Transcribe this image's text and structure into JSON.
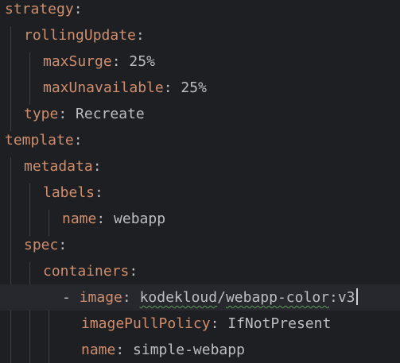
{
  "editor": {
    "language": "yaml",
    "lines": [
      {
        "indent": 0,
        "key": "strategy",
        "value": ""
      },
      {
        "indent": 1,
        "key": "rollingUpdate",
        "value": ""
      },
      {
        "indent": 2,
        "key": "maxSurge",
        "value": "25%"
      },
      {
        "indent": 2,
        "key": "maxUnavailable",
        "value": "25%"
      },
      {
        "indent": 1,
        "key": "type",
        "value": "Recreate"
      },
      {
        "indent": 0,
        "key": "template",
        "value": ""
      },
      {
        "indent": 1,
        "key": "metadata",
        "value": ""
      },
      {
        "indent": 2,
        "key": "labels",
        "value": ""
      },
      {
        "indent": 3,
        "key": "name",
        "value": "webapp"
      },
      {
        "indent": 1,
        "key": "spec",
        "value": ""
      },
      {
        "indent": 2,
        "key": "containers",
        "value": ""
      },
      {
        "indent": 3,
        "dash": "- ",
        "key": "image",
        "value_parts": [
          "kodekloud",
          "/",
          "webapp-color",
          ":v3"
        ],
        "current": true
      },
      {
        "indent": 4,
        "key": "imagePullPolicy",
        "value": "IfNotPresent"
      },
      {
        "indent": 4,
        "key": "name",
        "value": "simple-webapp"
      }
    ]
  },
  "colors": {
    "background": "#1e1f22",
    "current_line": "#26282e",
    "key": "#cf8e6d",
    "text": "#bcbec4",
    "typo_underline": "#5e9d5c"
  }
}
